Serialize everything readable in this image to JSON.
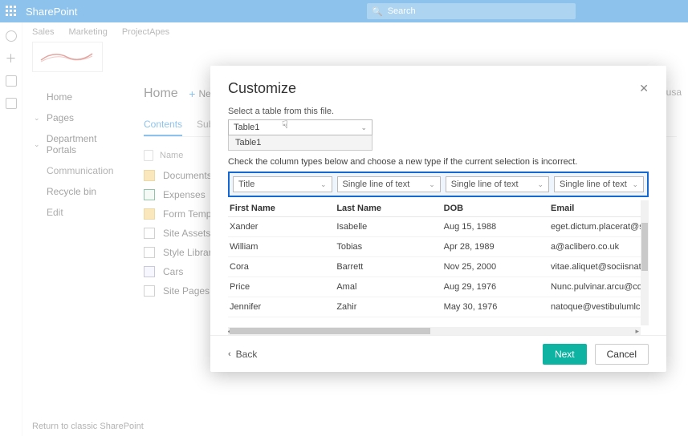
{
  "header": {
    "brand": "SharePoint",
    "search_placeholder": "Search"
  },
  "site": {
    "nav": [
      "Sales",
      "Marketing",
      "ProjectApes"
    ]
  },
  "leftnav": {
    "home": "Home",
    "pages": "Pages",
    "portals": "Department Portals",
    "communication": "Communication",
    "recycle": "Recycle bin",
    "edit": "Edit",
    "return": "Return to classic SharePoint"
  },
  "main": {
    "title": "Home",
    "new_label": "New",
    "siteusage": "Site usa",
    "tabs": {
      "contents": "Contents",
      "subsites": "Subsites"
    },
    "colhdr": "Name",
    "rows": [
      {
        "icon": "folder",
        "name": "Documents"
      },
      {
        "icon": "xls",
        "name": "Expenses"
      },
      {
        "icon": "folder",
        "name": "Form Templates"
      },
      {
        "icon": "lib",
        "name": "Site Assets"
      },
      {
        "icon": "lib",
        "name": "Style Library"
      },
      {
        "icon": "gen",
        "name": "Cars"
      },
      {
        "icon": "lib",
        "name": "Site Pages"
      }
    ]
  },
  "modal": {
    "title": "Customize",
    "select_label": "Select a table from this file.",
    "table_value": "Table1",
    "dropdown_opt": "Table1",
    "instruction": "Check the column types below and choose a new type if the current selection is incorrect.",
    "coltypes": [
      "Title",
      "Single line of text",
      "Single line of text",
      "Single line of text"
    ],
    "headers": [
      "First Name",
      "Last Name",
      "DOB",
      "Email"
    ],
    "rows": [
      {
        "c1": "Xander",
        "c2": "Isabelle",
        "c3": "Aug 15, 1988",
        "c4": "eget.dictum.placerat@s"
      },
      {
        "c1": "William",
        "c2": "Tobias",
        "c3": "Apr 28, 1989",
        "c4": "a@aclibero.co.uk"
      },
      {
        "c1": "Cora",
        "c2": "Barrett",
        "c3": "Nov 25, 2000",
        "c4": "vitae.aliquet@sociisnat"
      },
      {
        "c1": "Price",
        "c2": "Amal",
        "c3": "Aug 29, 1976",
        "c4": "Nunc.pulvinar.arcu@co"
      },
      {
        "c1": "Jennifer",
        "c2": "Zahir",
        "c3": "May 30, 1976",
        "c4": "natoque@vestibulumlc"
      }
    ],
    "back": "Back",
    "next": "Next",
    "cancel": "Cancel"
  }
}
